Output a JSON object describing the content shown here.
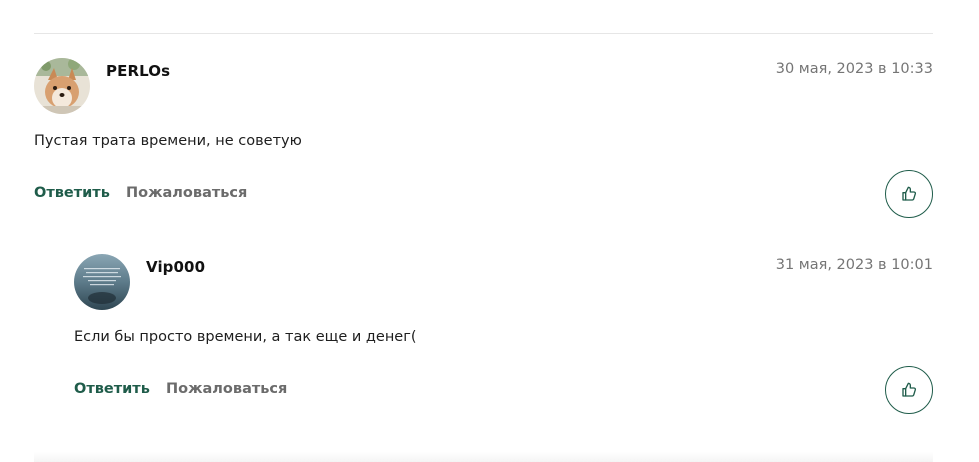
{
  "comments": [
    {
      "author": "PERLOs",
      "date": "30 мая, 2023 в 10:33",
      "text": "Пустая трата времени, не советую",
      "reply_label": "Ответить",
      "report_label": "Пожаловаться",
      "like_icon": "thumbs-up-icon"
    },
    {
      "author": "Vip000",
      "date": "31 мая, 2023 в 10:01",
      "text": "Если бы просто времени, а так еще и денег(",
      "reply_label": "Ответить",
      "report_label": "Пожаловаться",
      "like_icon": "thumbs-up-icon"
    }
  ],
  "colors": {
    "accent": "#1f5c4a",
    "muted_text": "#757575",
    "divider": "#e6e6e6"
  }
}
